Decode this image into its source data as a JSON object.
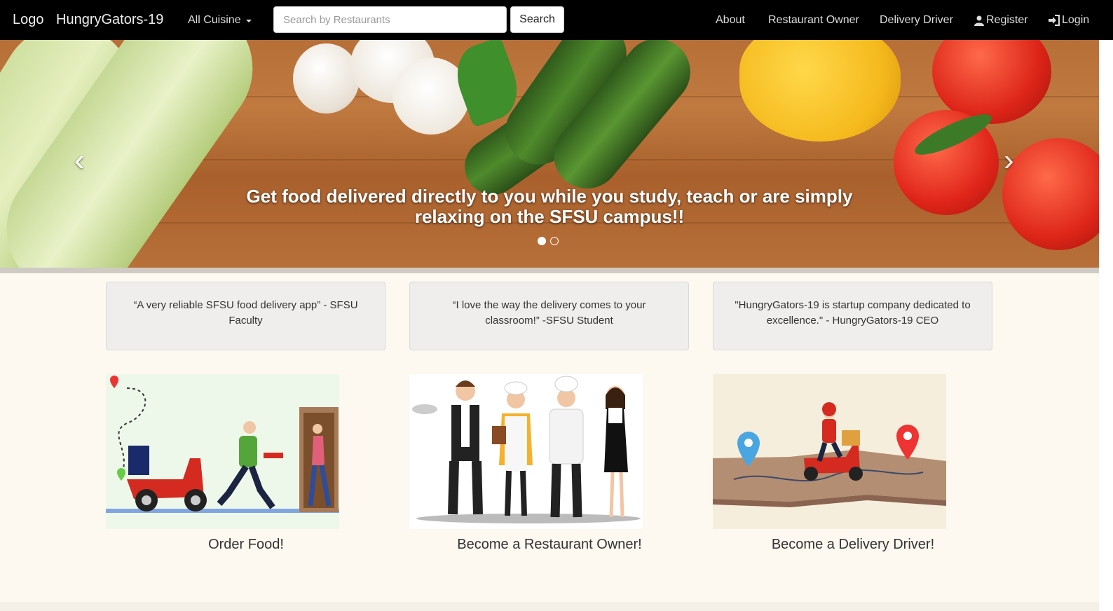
{
  "nav": {
    "logo": "Logo",
    "brand": "HungryGators-19",
    "cuisine_dropdown": "All Cuisine",
    "search_placeholder": "Search by Restaurants",
    "search_button": "Search",
    "links": {
      "about": "About",
      "restaurant_owner": "Restaurant Owner",
      "delivery_driver": "Delivery Driver",
      "register": "Register",
      "login": "Login"
    }
  },
  "hero": {
    "caption_line1": "Get food delivered directly to you while you study, teach or are simply",
    "caption_line2": "relaxing on the SFSU campus!!",
    "prev_arrow": "‹",
    "next_arrow": "›",
    "slide_count": 2,
    "active_slide": 1
  },
  "testimonials": [
    {
      "text": "“A very reliable SFSU food delivery app” - SFSU Faculty"
    },
    {
      "text": "“I love the way the delivery comes to your classroom!” -SFSU Student"
    },
    {
      "text": "\"HungryGators-19 is startup company dedicated to excellence.\" - HungryGators-19 CEO"
    }
  ],
  "features": [
    {
      "title": "Order Food!",
      "image": "delivery-illustration"
    },
    {
      "title": "Become a Restaurant Owner!",
      "image": "restaurant-staff-illustration"
    },
    {
      "title": "Become a Delivery Driver!",
      "image": "scooter-map-illustration"
    }
  ],
  "colors": {
    "navbar": "#000000",
    "page_background": "#fdf8f0",
    "card_background": "#efeeec"
  }
}
